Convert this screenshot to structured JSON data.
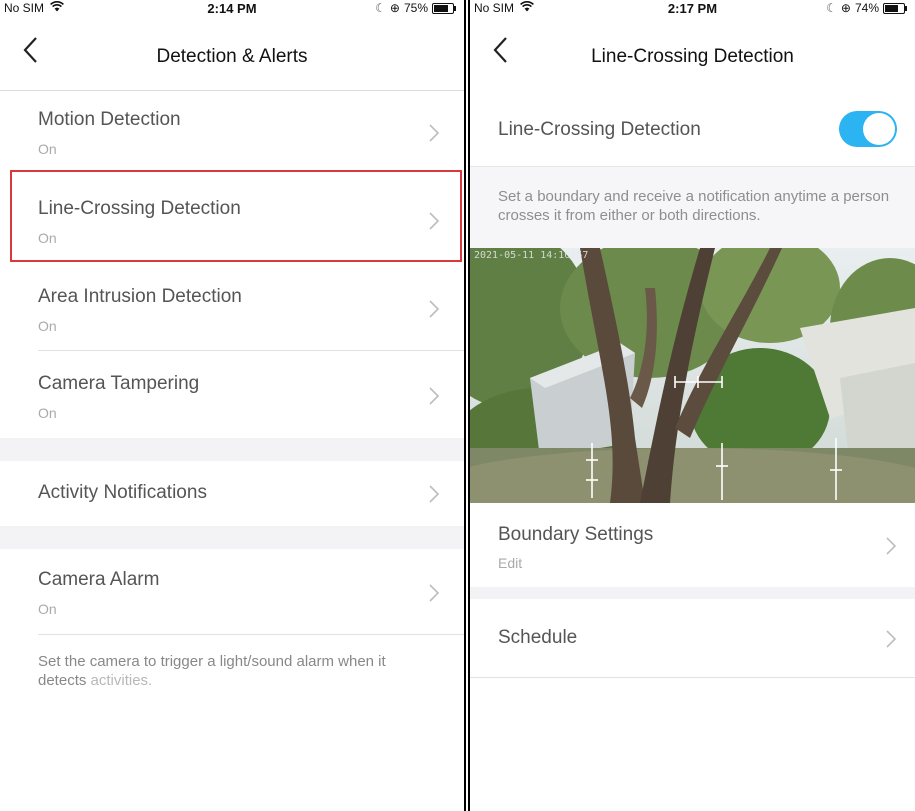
{
  "left": {
    "status": {
      "carrier": "No SIM",
      "wifi": "wifi-icon",
      "time": "2:14 PM",
      "battery_percent": "75%",
      "battery_level": 0.75
    },
    "nav": {
      "title": "Detection & Alerts",
      "back_icon": "chevron-left-icon"
    },
    "items": [
      {
        "label": "Motion Detection",
        "sub": "On"
      },
      {
        "label": "Line-Crossing Detection",
        "sub": "On"
      },
      {
        "label": "Area Intrusion Detection",
        "sub": "On"
      },
      {
        "label": "Camera Tampering",
        "sub": "On"
      },
      {
        "label": "Activity Notifications"
      },
      {
        "label": "Camera Alarm",
        "sub": "On"
      }
    ],
    "alarm_note": {
      "text": "Set the camera to trigger a light/sound alarm when it detects ",
      "faded": "activities."
    }
  },
  "right": {
    "status": {
      "carrier": "No SIM",
      "wifi": "wifi-icon",
      "time": "2:17 PM",
      "battery_percent": "74%",
      "battery_level": 0.74
    },
    "nav": {
      "title": "Line-Crossing Detection",
      "back_icon": "chevron-left-icon"
    },
    "toggle": {
      "label": "Line-Crossing Detection",
      "on": true,
      "color": "#2bb3f2"
    },
    "description": "Set a boundary and receive a notification anytime a person crosses it from either or both directions.",
    "camera": {
      "timestamp": "2021-05-11 14:16:57"
    },
    "boundary": {
      "label": "Boundary Settings",
      "sub": "Edit"
    },
    "schedule": {
      "label": "Schedule"
    }
  },
  "colors": {
    "highlight": "#d9393a",
    "accent": "#2bb3f2",
    "gap": "#f3f3f5"
  }
}
